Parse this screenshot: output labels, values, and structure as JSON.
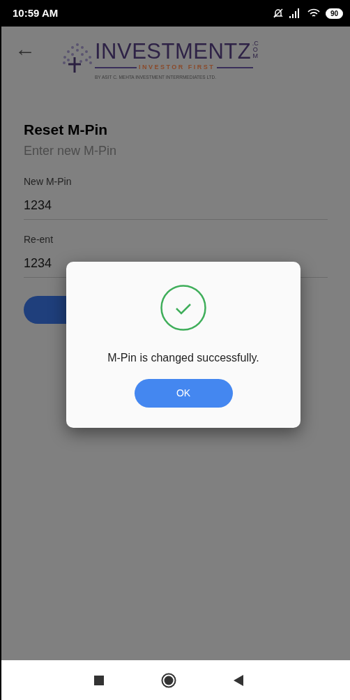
{
  "status_bar": {
    "time": "10:59 AM",
    "battery": "90"
  },
  "header": {
    "back": "←",
    "logo": {
      "name": "INVESTMENTZ",
      "suffix": ".COM",
      "tagline": "INVESTOR FIRST",
      "byline": "BY ASIT C. MEHTA INVESTMENT INTERRMEDIATES LTD."
    }
  },
  "form": {
    "title": "Reset M-Pin",
    "subtitle": "Enter new M-Pin",
    "fields": [
      {
        "label": "New M-Pin",
        "value": "1234"
      },
      {
        "label": "Re-ent",
        "value": "1234"
      }
    ]
  },
  "dialog": {
    "message": "M-Pin is changed successfully.",
    "button": "OK"
  }
}
